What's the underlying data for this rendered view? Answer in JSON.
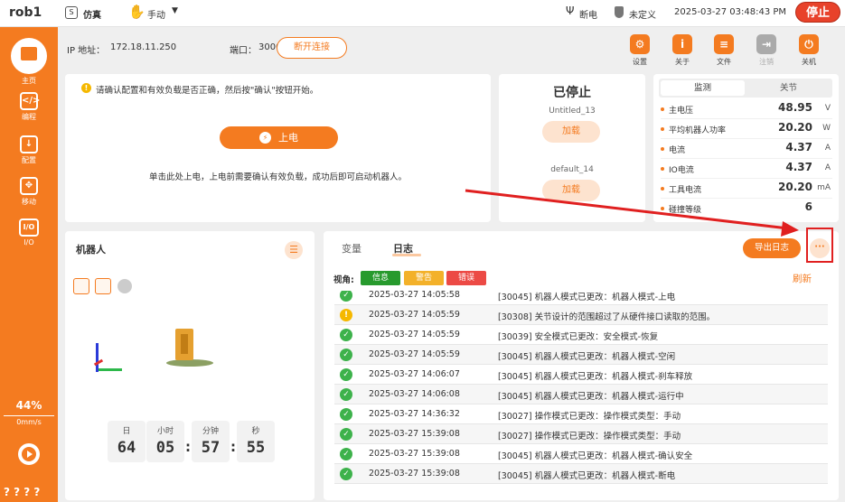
{
  "topbar": {
    "robot_name": "rob1",
    "sim_label": "仿真",
    "mode_label": "手动",
    "power_label": "断电",
    "tool_label": "未定义",
    "datetime": "2025-03-27 03:48:43 PM",
    "stop_label": "停止"
  },
  "sidebar": {
    "items": [
      {
        "label": "主页",
        "icon": "home-icon"
      },
      {
        "label": "编程",
        "icon": "code-icon"
      },
      {
        "label": "配置",
        "icon": "download-icon"
      },
      {
        "label": "移动",
        "icon": "move-icon"
      },
      {
        "label": "I/O",
        "icon": "io-icon"
      }
    ],
    "speed_percent": "44%",
    "speed_value": "0mm/s",
    "help": "? ? ? ?"
  },
  "connection": {
    "ip_label": "IP 地址：",
    "ip_value": "172.18.11.250",
    "port_label": "端口：",
    "port_value": "30000",
    "disconnect_label": "断开连接"
  },
  "toolbar": [
    {
      "label": "设置",
      "icon": "gear-icon"
    },
    {
      "label": "关于",
      "icon": "info-icon"
    },
    {
      "label": "文件",
      "icon": "file-icon"
    },
    {
      "label": "注销",
      "icon": "logout-icon"
    },
    {
      "label": "关机",
      "icon": "power-icon"
    }
  ],
  "power": {
    "notice": "请确认配置和有效负载是否正确，然后按\"确认\"按钮开始。",
    "button_label": "上电",
    "hint": "单击此处上电，上电前需要确认有效负载，成功后即可启动机器人。"
  },
  "program": {
    "status": "已停止",
    "program1": "Untitled_13",
    "load1": "加载",
    "program2": "default_14",
    "load2": "加载"
  },
  "monitor": {
    "tabs": [
      "监测",
      "关节"
    ],
    "rows": [
      {
        "label": "主电压",
        "value": "48.95",
        "unit": "V"
      },
      {
        "label": "平均机器人功率",
        "value": "20.20",
        "unit": "W"
      },
      {
        "label": "电流",
        "value": "4.37",
        "unit": "A"
      },
      {
        "label": "IO电流",
        "value": "4.37",
        "unit": "A"
      },
      {
        "label": "工具电流",
        "value": "20.20",
        "unit": "mA"
      },
      {
        "label": "碰撞等级",
        "value": "6",
        "unit": ""
      }
    ]
  },
  "robot": {
    "title": "机器人",
    "timer": [
      {
        "label": "日",
        "value": "64"
      },
      {
        "label": "小时",
        "value": "05"
      },
      {
        "label": "分钟",
        "value": "57"
      },
      {
        "label": "秒",
        "value": "55"
      }
    ]
  },
  "log": {
    "tab_vars": "变量",
    "tab_log": "日志",
    "export_label": "导出日志",
    "more_label": "···",
    "view_label": "视角:",
    "filters": [
      "信息",
      "警告",
      "错误"
    ],
    "refresh_label": "刷新",
    "rows": [
      {
        "status": "ok",
        "time": "2025-03-27 14:05:58",
        "msg": "[30045] 机器人模式已更改：机器人模式-上电"
      },
      {
        "status": "warn",
        "time": "2025-03-27 14:05:59",
        "msg": "[30308] 关节设计的范围超过了从硬件接口读取的范围。"
      },
      {
        "status": "ok",
        "time": "2025-03-27 14:05:59",
        "msg": "[30039] 安全模式已更改：安全模式-恢复"
      },
      {
        "status": "ok",
        "time": "2025-03-27 14:05:59",
        "msg": "[30045] 机器人模式已更改：机器人模式-空闲"
      },
      {
        "status": "ok",
        "time": "2025-03-27 14:06:07",
        "msg": "[30045] 机器人模式已更改：机器人模式-刹车释放"
      },
      {
        "status": "ok",
        "time": "2025-03-27 14:06:08",
        "msg": "[30045] 机器人模式已更改：机器人模式-运行中"
      },
      {
        "status": "ok",
        "time": "2025-03-27 14:36:32",
        "msg": "[30027] 操作模式已更改：操作模式类型：手动"
      },
      {
        "status": "ok",
        "time": "2025-03-27 15:39:08",
        "msg": "[30027] 操作模式已更改：操作模式类型：手动"
      },
      {
        "status": "ok",
        "time": "2025-03-27 15:39:08",
        "msg": "[30045] 机器人模式已更改：机器人模式-确认安全"
      },
      {
        "status": "ok",
        "time": "2025-03-27 15:39:08",
        "msg": "[30045] 机器人模式已更改：机器人模式-断电"
      }
    ]
  },
  "colors": {
    "accent": "#f47b20",
    "ok": "#3db24b",
    "warn": "#f5b800",
    "error": "#e84c3d",
    "annotation": "#e02020"
  }
}
